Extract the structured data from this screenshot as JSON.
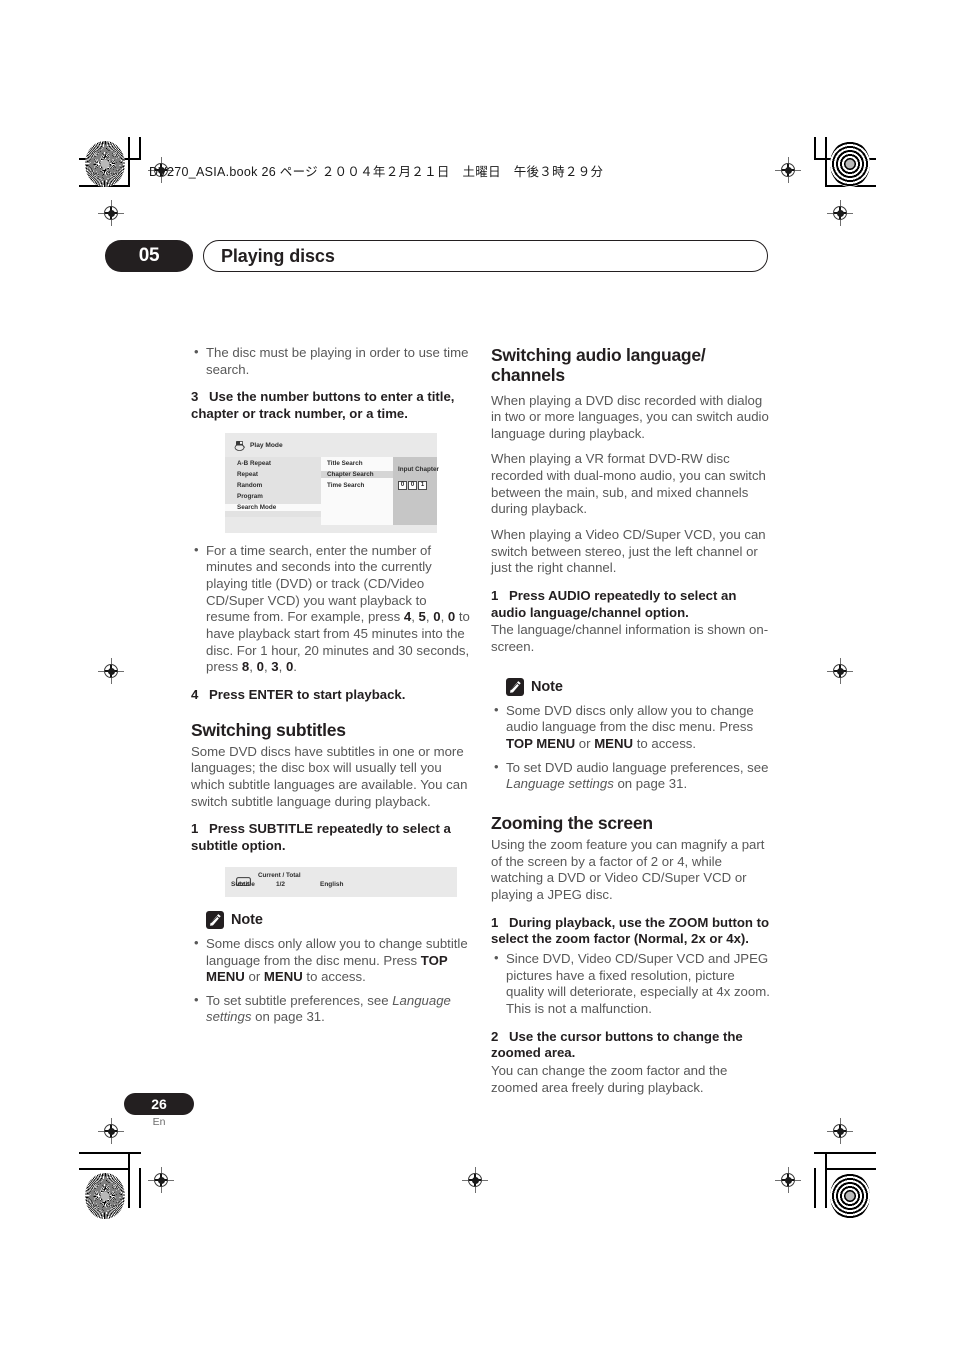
{
  "print_marks": {
    "file_header": "DV270_ASIA.book  26 ページ  ２００４年２月２１日　土曜日　午後３時２９分"
  },
  "header": {
    "chapter_number": "05",
    "chapter_title": "Playing discs"
  },
  "footer": {
    "page_number": "26",
    "language_code": "En"
  },
  "left_column": {
    "intro_bullets": [
      "The disc must be playing in order to use time search."
    ],
    "step3": {
      "number": "3",
      "text": "Use the number buttons to enter a title, chapter or track number, or a time."
    },
    "osd_play_mode": {
      "title": "Play Mode",
      "icon": "disc-play-mode-icon",
      "menu_column1": [
        "A-B Repeat",
        "Repeat",
        "Random",
        "Program",
        "Search Mode"
      ],
      "menu_column1_selected": "Search Mode",
      "menu_column2": [
        "Title Search",
        "Chapter Search",
        "Time Search"
      ],
      "menu_column2_selected": "Chapter Search",
      "input_label": "Input Chapter",
      "input_digits": [
        "0",
        "0",
        "1"
      ]
    },
    "time_search_bullet": {
      "prefix": "For a time search, enter the number of minutes and seconds into the currently playing title (DVD) or track (CD/Video CD/Super VCD) you want playback to resume from. For example, press ",
      "keys1": [
        "4",
        "5",
        "0",
        "0"
      ],
      "middle": " to have playback start from 45 minutes into the disc. For 1 hour, 20 minutes and 30 seconds, press ",
      "keys2": [
        "8",
        "0",
        "3",
        "0"
      ],
      "suffix": "."
    },
    "step4": {
      "number": "4",
      "text": "Press ENTER to start playback."
    },
    "switching_subtitles": {
      "heading": "Switching subtitles",
      "body": "Some DVD discs have subtitles in one or more languages; the disc box will usually tell you which subtitle languages are available. You can switch subtitle language during playback.",
      "step1": {
        "number": "1",
        "text": "Press SUBTITLE repeatedly to select a subtitle option."
      },
      "osd_subtitle": {
        "icon": "subtitle-icon",
        "current_total_label": "Current / Total",
        "row_label": "Subtitle",
        "row_value": "1/2",
        "row_language": "English"
      },
      "note": {
        "label": "Note",
        "icon": "pencil-note-icon",
        "bullets": [
          {
            "part1": "Some discs only allow you to change subtitle language from the disc menu. Press ",
            "bold1": "TOP MENU",
            "part2": " or ",
            "bold2": "MENU",
            "part3": " to access."
          },
          {
            "part1": "To set subtitle preferences, see ",
            "italic1": "Language settings",
            "part2": " on page 31."
          }
        ]
      }
    }
  },
  "right_column": {
    "switching_audio": {
      "heading": "Switching audio language/ channels",
      "paragraphs": [
        "When playing a DVD disc recorded with dialog in two or more languages, you can switch audio language during playback.",
        "When playing a VR format DVD-RW disc recorded with dual-mono audio, you can switch between the main, sub, and mixed channels during playback.",
        "When playing a Video CD/Super VCD, you can switch between stereo, just the left channel or just the right channel."
      ],
      "step1": {
        "number": "1",
        "text": "Press AUDIO repeatedly to select an audio language/channel option."
      },
      "step1_body": "The language/channel information is shown on-screen.",
      "note": {
        "label": "Note",
        "icon": "pencil-note-icon",
        "bullets": [
          {
            "part1": "Some DVD discs only allow you to change audio language from the disc menu. Press ",
            "bold1": "TOP MENU",
            "part2": " or ",
            "bold2": "MENU",
            "part3": " to access."
          },
          {
            "part1": "To set DVD audio language preferences, see ",
            "italic1": "Language settings",
            "part2": " on page 31."
          }
        ]
      }
    },
    "zooming": {
      "heading": "Zooming the screen",
      "body": "Using the zoom feature you can magnify a part of the screen by a factor of 2 or 4, while watching a DVD or Video CD/Super VCD or playing a JPEG disc.",
      "step1": {
        "number": "1",
        "text": "During playback, use the ZOOM button to select the zoom factor (Normal, 2x or 4x)."
      },
      "step1_bullets": [
        "Since DVD, Video CD/Super VCD and JPEG pictures have a fixed resolution, picture quality will deteriorate, especially at 4x zoom. This is not a malfunction."
      ],
      "step2": {
        "number": "2",
        "text": "Use the cursor buttons to change the zoomed area."
      },
      "step2_body": "You can change the zoom factor and the zoomed area freely during playback."
    }
  }
}
